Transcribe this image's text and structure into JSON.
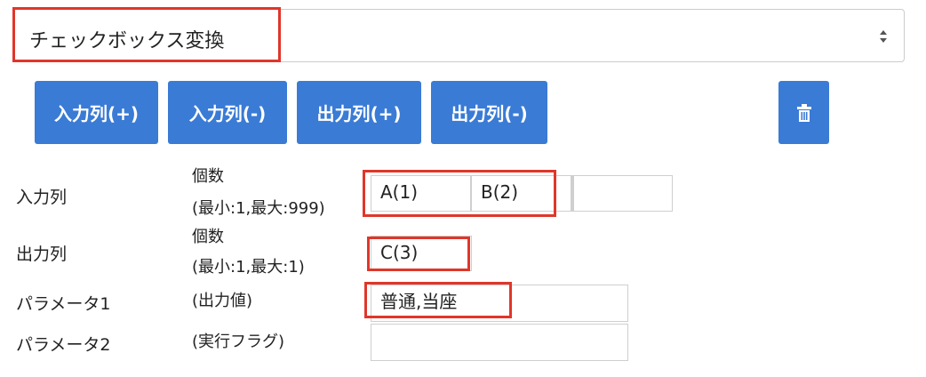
{
  "converter_select": {
    "value": "チェックボックス変換"
  },
  "toolbar": {
    "add_input_label": "入力列(+)",
    "remove_input_label": "入力列(-)",
    "add_output_label": "出力列(+)",
    "remove_output_label": "出力列(-)",
    "delete_icon": "trash-icon"
  },
  "rows": {
    "input": {
      "label": "入力列",
      "count_line1": "個数",
      "count_line2": "(最小:1,最大:999)",
      "cells": [
        "A(1)",
        "B(2)",
        "",
        ""
      ]
    },
    "output": {
      "label": "出力列",
      "count_line1": "個数",
      "count_line2": "(最小:1,最大:1)",
      "cells": [
        "C(3)"
      ]
    },
    "param1": {
      "label": "パラメータ1",
      "hint": "(出力値)",
      "value": "普通,当座"
    },
    "param2": {
      "label": "パラメータ2",
      "hint": "(実行フラグ)",
      "value": ""
    }
  },
  "colors": {
    "button": "#3a7bd5",
    "highlight": "#e0362a"
  }
}
